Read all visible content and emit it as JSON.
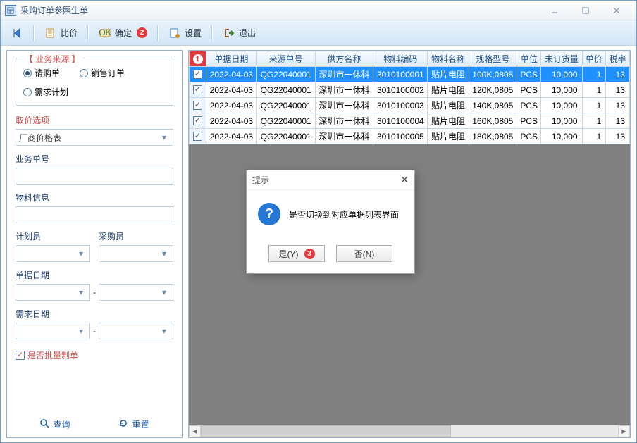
{
  "window": {
    "title": "采购订单参照生单"
  },
  "toolbar": {
    "nav_first": "",
    "compare": "比价",
    "confirm": "确定",
    "confirm_badge": "2",
    "settings": "设置",
    "exit": "退出"
  },
  "sidebar": {
    "source_legend": "【 业务来源 】",
    "radios": {
      "purchase": "请购单",
      "sales": "销售订单",
      "demand": "需求计划"
    },
    "price_option_label": "取价选项",
    "price_option_value": "厂商价格表",
    "biz_no_label": "业务单号",
    "material_label": "物料信息",
    "planner_label": "计划员",
    "buyer_label": "采购员",
    "doc_date_label": "单据日期",
    "need_date_label": "需求日期",
    "batch_label": "是否批量制单",
    "range_sep": "-",
    "query": "查询",
    "reset": "重置"
  },
  "grid": {
    "corner_badge": "1",
    "headers": [
      "单据日期",
      "来源单号",
      "供方名称",
      "物料编码",
      "物料名称",
      "规格型号",
      "单位",
      "未订货量",
      "单价",
      "税率"
    ],
    "rows": [
      {
        "sel": true,
        "date": "2022-04-03",
        "src": "QG22040001",
        "supplier": "深圳市一休科",
        "mat_code": "3010100001",
        "mat_name": "贴片电阻",
        "spec": "100K,0805",
        "unit": "PCS",
        "qty": "10,000",
        "price": "1",
        "tax": "13"
      },
      {
        "sel": false,
        "date": "2022-04-03",
        "src": "QG22040001",
        "supplier": "深圳市一休科",
        "mat_code": "3010100002",
        "mat_name": "贴片电阻",
        "spec": "120K,0805",
        "unit": "PCS",
        "qty": "10,000",
        "price": "1",
        "tax": "13"
      },
      {
        "sel": false,
        "date": "2022-04-03",
        "src": "QG22040001",
        "supplier": "深圳市一休科",
        "mat_code": "3010100003",
        "mat_name": "贴片电阻",
        "spec": "140K,0805",
        "unit": "PCS",
        "qty": "10,000",
        "price": "1",
        "tax": "13"
      },
      {
        "sel": false,
        "date": "2022-04-03",
        "src": "QG22040001",
        "supplier": "深圳市一休科",
        "mat_code": "3010100004",
        "mat_name": "贴片电阻",
        "spec": "160K,0805",
        "unit": "PCS",
        "qty": "10,000",
        "price": "1",
        "tax": "13"
      },
      {
        "sel": false,
        "date": "2022-04-03",
        "src": "QG22040001",
        "supplier": "深圳市一休科",
        "mat_code": "3010100005",
        "mat_name": "贴片电阻",
        "spec": "180K,0805",
        "unit": "PCS",
        "qty": "10,000",
        "price": "1",
        "tax": "13"
      }
    ]
  },
  "modal": {
    "title": "提示",
    "message": "是否切换到对应单据列表界面",
    "yes": "是(Y)",
    "yes_badge": "3",
    "no": "否(N)"
  }
}
